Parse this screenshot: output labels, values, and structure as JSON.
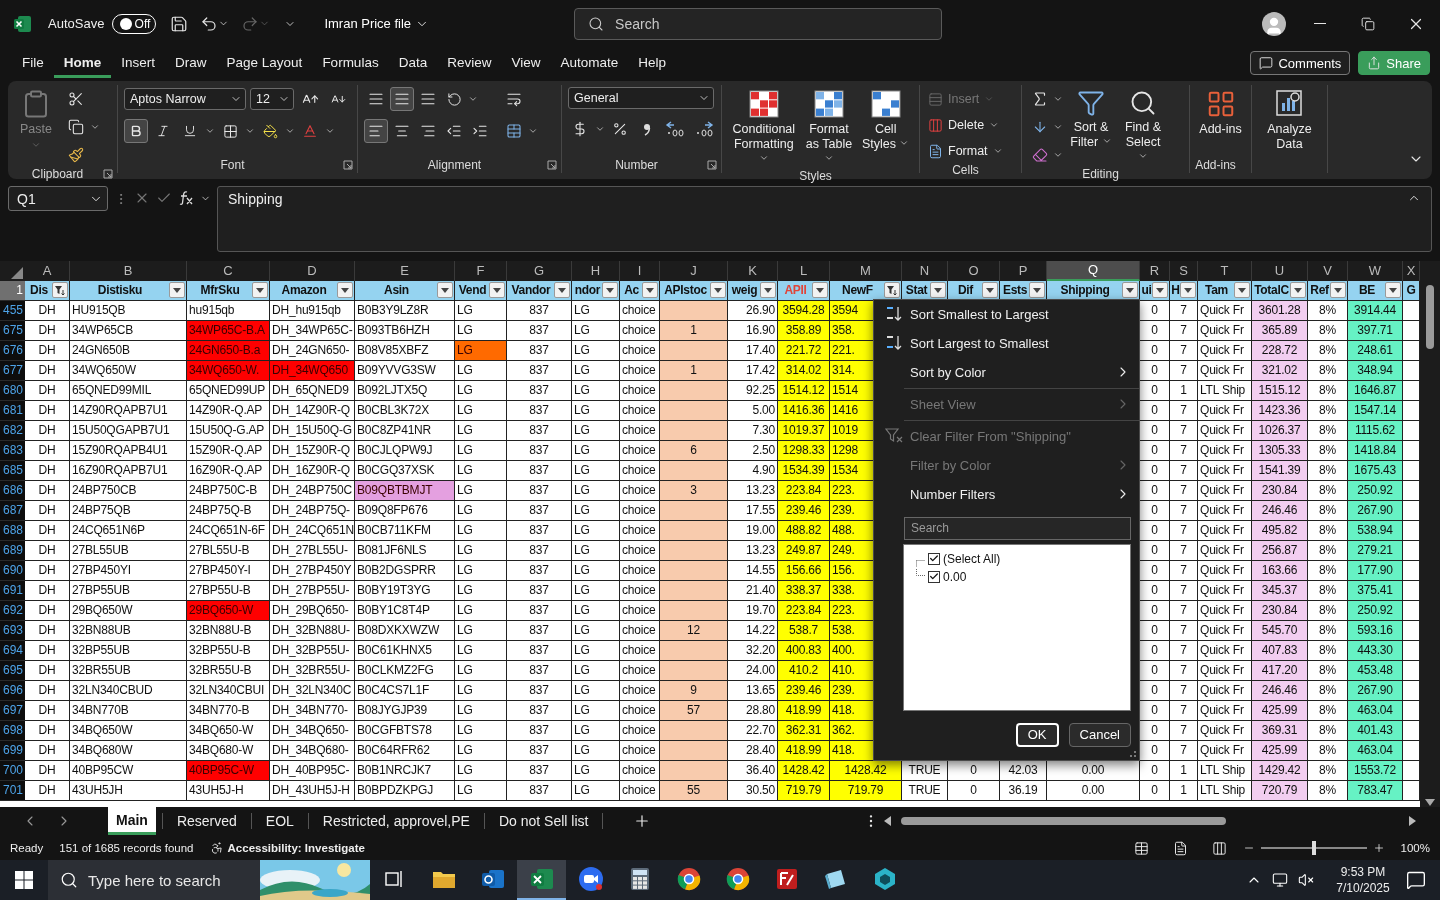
{
  "title_bar": {
    "autosave_label": "AutoSave",
    "autosave": {
      "on": false,
      "label": "Off"
    },
    "file_name": "Imran Price file",
    "search": {
      "placeholder": "Search"
    }
  },
  "menu_tabs": [
    {
      "label": "File",
      "selected": false
    },
    {
      "label": "Home",
      "selected": true
    },
    {
      "label": "Insert",
      "selected": false
    },
    {
      "label": "Draw",
      "selected": false
    },
    {
      "label": "Page Layout",
      "selected": false
    },
    {
      "label": "Formulas",
      "selected": false
    },
    {
      "label": "Data",
      "selected": false
    },
    {
      "label": "Review",
      "selected": false
    },
    {
      "label": "View",
      "selected": false
    },
    {
      "label": "Automate",
      "selected": false
    },
    {
      "label": "Help",
      "selected": false
    }
  ],
  "header_buttons": {
    "comments": "Comments",
    "share": "Share"
  },
  "ribbon": {
    "clipboard": {
      "paste": {
        "label": "Paste",
        "disabled": true
      },
      "label": "Clipboard"
    },
    "font": {
      "name": "Aptos Narrow",
      "size": "12",
      "label": "Font"
    },
    "alignment": {
      "label": "Alignment"
    },
    "number": {
      "format": "General",
      "label": "Number"
    },
    "styles": {
      "buttons": [
        "Conditional Formatting",
        "Format as Table",
        "Cell Styles"
      ],
      "label": "Styles"
    },
    "cells": {
      "buttons": [
        {
          "label": "Insert",
          "disabled": true
        },
        {
          "label": "Delete",
          "disabled": false
        },
        {
          "label": "Format",
          "disabled": false
        }
      ],
      "label": "Cells"
    },
    "editing": {
      "buttons": [
        "Sort & Filter",
        "Find & Select"
      ],
      "label": "Editing"
    },
    "add_ins": {
      "button": "Add-ins",
      "label": "Add-ins"
    },
    "analyze": {
      "button": "Analyze Data"
    }
  },
  "formula_bar": {
    "name_box": "Q1",
    "formula": "Shipping"
  },
  "sheet": {
    "header_row_number": "1",
    "columns": [
      {
        "letter": "A",
        "header": "Dis",
        "filter_applied": true,
        "selected": false
      },
      {
        "letter": "B",
        "header": "Distisku",
        "filter_applied": false,
        "selected": false
      },
      {
        "letter": "C",
        "header": "MfrSku",
        "filter_applied": false,
        "selected": false
      },
      {
        "letter": "D",
        "header": "Amazon",
        "filter_applied": false,
        "selected": false
      },
      {
        "letter": "E",
        "header": "Asin",
        "filter_applied": false,
        "selected": false
      },
      {
        "letter": "F",
        "header": "Vend",
        "filter_applied": false,
        "selected": false
      },
      {
        "letter": "G",
        "header": "Vandor",
        "filter_applied": false,
        "selected": false
      },
      {
        "letter": "H",
        "header": "ndor",
        "filter_applied": false,
        "selected": false
      },
      {
        "letter": "I",
        "header": "Ac",
        "filter_applied": false,
        "selected": false
      },
      {
        "letter": "J",
        "header": "APIstoc",
        "filter_applied": false,
        "selected": false,
        "color": "#f8cbad"
      },
      {
        "letter": "K",
        "header": "weig",
        "filter_applied": false,
        "selected": false
      },
      {
        "letter": "L",
        "header": {
          "text": "APII",
          "color": "#e0453a"
        },
        "filter_applied": false,
        "selected": false,
        "color": "#ffff00"
      },
      {
        "letter": "M",
        "header": "NewF",
        "filter_applied": true,
        "selected": false,
        "color": "#ffff00"
      },
      {
        "letter": "N",
        "header": "Stat",
        "filter_applied": false,
        "selected": false
      },
      {
        "letter": "O",
        "header": "Dif",
        "filter_applied": false,
        "selected": false
      },
      {
        "letter": "P",
        "header": "Ests",
        "filter_applied": false,
        "selected": false
      },
      {
        "letter": "Q",
        "header": "Shipping",
        "filter_applied": false,
        "selected": true
      },
      {
        "letter": "R",
        "header": "ui",
        "filter_applied": false,
        "selected": false
      },
      {
        "letter": "S",
        "header": "H",
        "filter_applied": false,
        "selected": false
      },
      {
        "letter": "T",
        "header": "Tam",
        "filter_applied": false,
        "selected": false
      },
      {
        "letter": "U",
        "header": "TotalC",
        "filter_applied": false,
        "selected": false,
        "color": "#f2cef0"
      },
      {
        "letter": "V",
        "header": "Ref",
        "filter_applied": false,
        "selected": false
      },
      {
        "letter": "W",
        "header": "BE",
        "filter_applied": false,
        "selected": false,
        "color": "#66f2c4"
      },
      {
        "letter": "X",
        "header": "G",
        "selected": false
      }
    ],
    "rows": [
      {
        "number": "455",
        "cells": [
          "DH",
          "HU915QB",
          "hu915qb",
          "DH_hu915qb",
          "B0B3Y9LZ8R",
          "LG",
          "837",
          "LG",
          "choice",
          "",
          "26.90",
          "3594.28",
          "3594",
          null,
          null,
          null,
          null,
          "0",
          "7",
          "Quick Fr",
          "3601.28",
          "8%",
          "3914.44"
        ]
      },
      {
        "number": "675",
        "cells": [
          "DH",
          "34WP65CB",
          {
            "text": "34WP65C-B.A",
            "color": "#ff0000"
          },
          "DH_34WP65C-",
          "B093TB6HZH",
          "LG",
          "837",
          "LG",
          "choice",
          "1",
          "16.90",
          "358.89",
          "358.",
          null,
          null,
          null,
          null,
          "0",
          "7",
          "Quick Fr",
          "365.89",
          "8%",
          "397.71"
        ]
      },
      {
        "number": "676",
        "cells": [
          "DH",
          "24GN650B",
          {
            "text": "24GN650-B.a",
            "color": "#ff0000"
          },
          "DH_24GN650-",
          "B08V85XBFZ",
          {
            "text": "LG",
            "color": "#ff6a00"
          },
          "837",
          "LG",
          "choice",
          "",
          "17.40",
          "221.72",
          "221.",
          null,
          null,
          null,
          null,
          "0",
          "7",
          "Quick Fr",
          "228.72",
          "8%",
          "248.61"
        ]
      },
      {
        "number": "677",
        "cells": [
          "DH",
          "34WQ650W",
          {
            "text": "34WQ650-W.",
            "color": "#ff0000"
          },
          {
            "text": "DH_34WQ650",
            "color": "#ff0000"
          },
          "B09YVVG3SW",
          "LG",
          "837",
          "LG",
          "choice",
          "1",
          "17.42",
          "314.02",
          "314.",
          null,
          null,
          null,
          null,
          "0",
          "7",
          "Quick Fr",
          "321.02",
          "8%",
          "348.94"
        ]
      },
      {
        "number": "680",
        "cells": [
          "DH",
          "65QNED99MIL",
          "65QNED99UP",
          "DH_65QNED9",
          "B092LJTX5Q",
          "LG",
          "837",
          "LG",
          "choice",
          "",
          "92.25",
          "1514.12",
          "1514",
          null,
          null,
          null,
          null,
          "0",
          "1",
          "LTL Ship",
          "1515.12",
          "8%",
          "1646.87"
        ]
      },
      {
        "number": "681",
        "cells": [
          "DH",
          "14Z90RQAPB7U1",
          "14Z90R-Q.AP",
          "DH_14Z90R-Q",
          "B0CBL3K72X",
          "LG",
          "837",
          "LG",
          "choice",
          "",
          "5.00",
          "1416.36",
          "1416",
          null,
          null,
          null,
          null,
          "0",
          "7",
          "Quick Fr",
          "1423.36",
          "8%",
          "1547.14"
        ]
      },
      {
        "number": "682",
        "cells": [
          "DH",
          "15U50QGAPB7U1",
          "15U50Q-G.AP",
          "DH_15U50Q-G",
          "B0C8ZP41NR",
          "LG",
          "837",
          "LG",
          "choice",
          "",
          "7.30",
          "1019.37",
          "1019",
          null,
          null,
          null,
          null,
          "0",
          "7",
          "Quick Fr",
          "1026.37",
          "8%",
          "1115.62"
        ]
      },
      {
        "number": "683",
        "cells": [
          "DH",
          "15Z90RQAPB4U1",
          "15Z90R-Q.AP",
          "DH_15Z90R-Q",
          "B0CJLQPW9J",
          "LG",
          "837",
          "LG",
          "choice",
          "6",
          "2.50",
          "1298.33",
          "1298",
          null,
          null,
          null,
          null,
          "0",
          "7",
          "Quick Fr",
          "1305.33",
          "8%",
          "1418.84"
        ]
      },
      {
        "number": "685",
        "cells": [
          "DH",
          "16Z90RQAPB7U1",
          "16Z90R-Q.AP",
          "DH_16Z90R-Q",
          "B0CGQ37XSK",
          "LG",
          "837",
          "LG",
          "choice",
          "",
          "4.90",
          "1534.39",
          "1534",
          null,
          null,
          null,
          null,
          "0",
          "7",
          "Quick Fr",
          "1541.39",
          "8%",
          "1675.43"
        ]
      },
      {
        "number": "686",
        "cells": [
          "DH",
          "24BP750CB",
          "24BP750C-B",
          "DH_24BP750C",
          {
            "text": "B09QBTBMJT",
            "color": "#e4a0e0"
          },
          "LG",
          "837",
          "LG",
          "choice",
          "3",
          "13.23",
          "223.84",
          "223.",
          null,
          null,
          null,
          null,
          "0",
          "7",
          "Quick Fr",
          "230.84",
          "8%",
          "250.92"
        ]
      },
      {
        "number": "687",
        "cells": [
          "DH",
          "24BP75QB",
          "24BP75Q-B",
          "DH_24BP75Q-",
          "B09Q8FP676",
          "LG",
          "837",
          "LG",
          "choice",
          "",
          "17.55",
          "239.46",
          "239.",
          null,
          null,
          null,
          null,
          "0",
          "7",
          "Quick Fr",
          "246.46",
          "8%",
          "267.90"
        ]
      },
      {
        "number": "688",
        "cells": [
          "DH",
          "24CQ651N6P",
          "24CQ651N-6F",
          "DH_24CQ651N",
          "B0CB711KFM",
          "LG",
          "837",
          "LG",
          "choice",
          "",
          "19.00",
          "488.82",
          "488.",
          null,
          null,
          null,
          null,
          "0",
          "7",
          "Quick Fr",
          "495.82",
          "8%",
          "538.94"
        ]
      },
      {
        "number": "689",
        "cells": [
          "DH",
          "27BL55UB",
          "27BL55U-B",
          "DH_27BL55U-",
          "B081JF6NLS",
          "LG",
          "837",
          "LG",
          "choice",
          "",
          "13.23",
          "249.87",
          "249.",
          null,
          null,
          null,
          null,
          "0",
          "7",
          "Quick Fr",
          "256.87",
          "8%",
          "279.21"
        ]
      },
      {
        "number": "690",
        "cells": [
          "DH",
          "27BP450YI",
          "27BP450Y-I",
          "DH_27BP450Y",
          "B0B2DGSPRR",
          "LG",
          "837",
          "LG",
          "choice",
          "",
          "14.55",
          "156.66",
          "156.",
          null,
          null,
          null,
          null,
          "0",
          "7",
          "Quick Fr",
          "163.66",
          "8%",
          "177.90"
        ]
      },
      {
        "number": "691",
        "cells": [
          "DH",
          "27BP55UB",
          "27BP55U-B",
          "DH_27BP55U-",
          "B0BY19T3YG",
          "LG",
          "837",
          "LG",
          "choice",
          "",
          "21.40",
          "338.37",
          "338.",
          null,
          null,
          null,
          null,
          "0",
          "7",
          "Quick Fr",
          "345.37",
          "8%",
          "375.41"
        ]
      },
      {
        "number": "692",
        "cells": [
          "DH",
          "29BQ650W",
          {
            "text": "29BQ650-W",
            "color": "#ff0000"
          },
          "DH_29BQ650-",
          "B0BY1C8T4P",
          "LG",
          "837",
          "LG",
          "choice",
          "",
          "19.70",
          "223.84",
          "223.",
          null,
          null,
          null,
          null,
          "0",
          "7",
          "Quick Fr",
          "230.84",
          "8%",
          "250.92"
        ]
      },
      {
        "number": "693",
        "cells": [
          "DH",
          "32BN88UB",
          "32BN88U-B",
          "DH_32BN88U-",
          "B08DXKXWZW",
          "LG",
          "837",
          "LG",
          "choice",
          "12",
          "14.22",
          "538.7",
          "538.",
          null,
          null,
          null,
          null,
          "0",
          "7",
          "Quick Fr",
          "545.70",
          "8%",
          "593.16"
        ]
      },
      {
        "number": "694",
        "cells": [
          "DH",
          "32BP55UB",
          "32BP55U-B",
          "DH_32BP55U-",
          "B0C61KHNX5",
          "LG",
          "837",
          "LG",
          "choice",
          "",
          "32.20",
          "400.83",
          "400.",
          null,
          null,
          null,
          null,
          "0",
          "7",
          "Quick Fr",
          "407.83",
          "8%",
          "443.30"
        ]
      },
      {
        "number": "695",
        "cells": [
          "DH",
          "32BR55UB",
          "32BR55U-B",
          "DH_32BR55U-",
          "B0CLKMZ2FG",
          "LG",
          "837",
          "LG",
          "choice",
          "",
          "24.00",
          "410.2",
          "410.",
          null,
          null,
          null,
          null,
          "0",
          "7",
          "Quick Fr",
          "417.20",
          "8%",
          "453.48"
        ]
      },
      {
        "number": "696",
        "cells": [
          "DH",
          "32LN340CBUD",
          "32LN340CBUI",
          "DH_32LN340C",
          "B0C4CS7L1F",
          "LG",
          "837",
          "LG",
          "choice",
          "9",
          "13.65",
          "239.46",
          "239.",
          null,
          null,
          null,
          null,
          "0",
          "7",
          "Quick Fr",
          "246.46",
          "8%",
          "267.90"
        ]
      },
      {
        "number": "697",
        "cells": [
          "DH",
          "34BN770B",
          "34BN770-B",
          "DH_34BN770-",
          "B08JYGJP39",
          "LG",
          "837",
          "LG",
          "choice",
          "57",
          "28.80",
          "418.99",
          "418.",
          null,
          null,
          null,
          null,
          "0",
          "7",
          "Quick Fr",
          "425.99",
          "8%",
          "463.04"
        ]
      },
      {
        "number": "698",
        "cells": [
          "DH",
          "34BQ650W",
          "34BQ650-W",
          "DH_34BQ650-",
          "B0CGFBTS78",
          "LG",
          "837",
          "LG",
          "choice",
          "",
          "22.70",
          "362.31",
          "362.",
          null,
          null,
          null,
          null,
          "0",
          "7",
          "Quick Fr",
          "369.31",
          "8%",
          "401.43"
        ]
      },
      {
        "number": "699",
        "cells": [
          "DH",
          "34BQ680W",
          "34BQ680-W",
          "DH_34BQ680-",
          "B0C64RFR62",
          "LG",
          "837",
          "LG",
          "choice",
          "",
          "28.40",
          "418.99",
          "418.",
          null,
          null,
          null,
          null,
          "0",
          "7",
          "Quick Fr",
          "425.99",
          "8%",
          "463.04"
        ]
      },
      {
        "number": "700",
        "cells": [
          "DH",
          "40BP95CW",
          {
            "text": "40BP95C-W",
            "color": "#ff0000"
          },
          "DH_40BP95C-",
          "B0B1NRCJK7",
          "LG",
          "837",
          "LG",
          "choice",
          "",
          "36.40",
          "1428.42",
          "1428.42",
          "TRUE",
          "0",
          "42.03",
          "0.00",
          "0",
          "1",
          "LTL Ship",
          "1429.42",
          "8%",
          "1553.72"
        ]
      },
      {
        "number": "701",
        "cells": [
          "DH",
          "43UH5JH",
          "43UH5J-H",
          "DH_43UH5J-H",
          "B0BPDZKPGJ",
          "LG",
          "837",
          "LG",
          "choice",
          "55",
          "30.50",
          "719.79",
          "719.79",
          "TRUE",
          "0",
          "36.19",
          "0.00",
          "0",
          "1",
          "LTL Ship",
          "720.79",
          "8%",
          "783.47"
        ]
      }
    ],
    "filter_menu": {
      "items": [
        {
          "kind": "sort-ascending",
          "label": "Sort Smallest to Largest",
          "disabled": false
        },
        {
          "kind": "sort-descending",
          "label": "Sort Largest to Smallest",
          "disabled": false
        },
        {
          "kind": "submenu",
          "label": "Sort by Color",
          "disabled": false
        },
        {
          "kind": "separator"
        },
        {
          "kind": "submenu",
          "label": "Sheet View",
          "disabled": true
        },
        {
          "kind": "separator"
        },
        {
          "kind": "clear-filter",
          "label": "Clear Filter From \"Shipping\"",
          "disabled": true
        },
        {
          "kind": "submenu",
          "label": "Filter by Color",
          "disabled": true
        },
        {
          "kind": "submenu",
          "label": "Number Filters",
          "disabled": false
        }
      ],
      "search": {
        "placeholder": "Search"
      },
      "values": [
        {
          "label": "(Select All)",
          "checked": true
        },
        {
          "label": "0.00",
          "checked": true
        }
      ],
      "buttons": [
        {
          "label": "OK",
          "focused": true
        },
        {
          "label": "Cancel",
          "focused": false
        }
      ]
    }
  },
  "sheet_tabs": [
    {
      "label": "Main",
      "selected": true
    },
    {
      "label": "Reserved",
      "selected": false
    },
    {
      "label": "EOL",
      "selected": false
    },
    {
      "label": "Restricted, approvel,PE",
      "selected": false
    },
    {
      "label": "Do not Sell list",
      "selected": false
    }
  ],
  "status_bar": {
    "mode": "Ready",
    "records": "151 of 1685 records found",
    "accessibility": "Accessibility: Investigate",
    "zoom": "100%",
    "zoom_slider": {
      "level": 0.5
    }
  },
  "taskbar": {
    "search": {
      "placeholder": "Type here to search"
    },
    "apps": [
      {
        "kind": "task-view",
        "selected": false
      },
      {
        "kind": "folder",
        "selected": false
      },
      {
        "kind": "mail",
        "selected": false
      },
      {
        "kind": "spreadsheet",
        "selected": true
      },
      {
        "kind": "video-call",
        "selected": false
      },
      {
        "kind": "calculator",
        "selected": false
      },
      {
        "kind": "browser",
        "selected": false
      },
      {
        "kind": "browser",
        "selected": false
      },
      {
        "kind": "ftp",
        "selected": false
      },
      {
        "kind": "notes",
        "selected": false
      },
      {
        "kind": "cube",
        "selected": false
      }
    ],
    "time": "9:53 PM",
    "date": "7/10/2025"
  }
}
